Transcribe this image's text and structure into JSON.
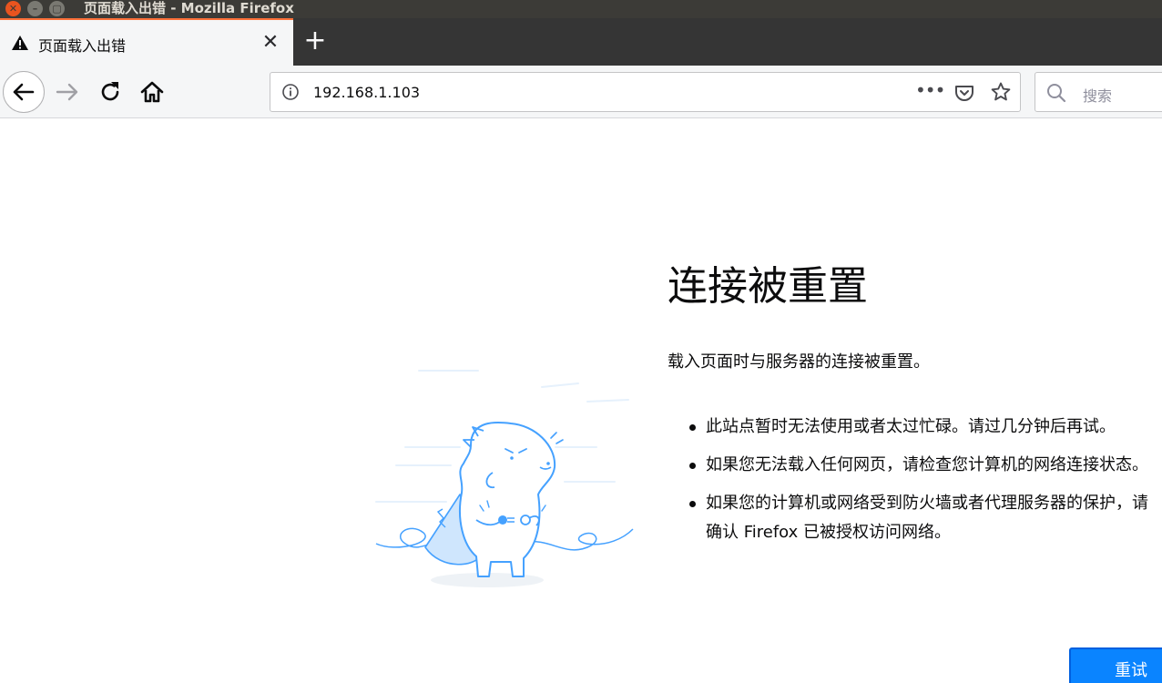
{
  "window": {
    "title": "页面载入出错 - Mozilla Firefox"
  },
  "tab": {
    "label": "页面载入出错",
    "icon": "warning-icon",
    "close_glyph": "✕"
  },
  "newtab": {
    "glyph": "+"
  },
  "navbar": {
    "url": "192.168.1.103",
    "page_actions_glyph": "•••",
    "search_placeholder": "搜索"
  },
  "error": {
    "title": "连接被重置",
    "description": "载入页面时与服务器的连接被重置。",
    "items": [
      "此站点暂时无法使用或者太过忙碌。请过几分钟后再试。",
      "如果您无法载入任何网页，请检查您计算机的网络连接状态。",
      "如果您的计算机或网络受到防火墙或者代理服务器的保护，请确认 Firefox 已被授权访问网络。"
    ],
    "retry_label": "重试"
  },
  "colors": {
    "accent": "#0a84ff",
    "tab_highlight": "#ff7139",
    "titlebar": "#3c3b37",
    "illustration": "#45a1ff"
  }
}
